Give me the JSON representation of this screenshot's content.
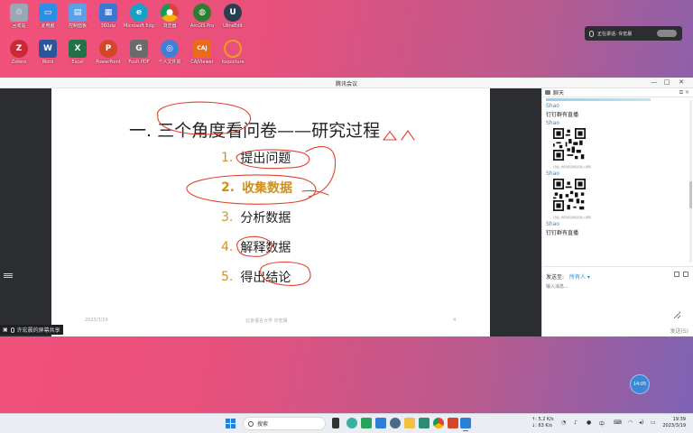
{
  "desktop": {
    "icons": [
      {
        "label": "回收站",
        "icon": "recycle-bin-icon",
        "color": "#9aa7b5"
      },
      {
        "label": "此电脑",
        "icon": "this-pc-icon",
        "color": "#2d8ee6"
      },
      {
        "label": "控制面板",
        "icon": "control-panel-icon",
        "color": "#5aa0e8"
      },
      {
        "label": "360zip",
        "icon": "archive-icon",
        "color": "#3a78d6"
      },
      {
        "label": "Microsoft Edge",
        "icon": "edge-icon",
        "color": "#1aa0c8"
      },
      {
        "label": "浏览器",
        "icon": "chrome-icon",
        "color": "#e4b321"
      },
      {
        "label": "ArcGIS Pro",
        "icon": "arcgis-icon",
        "color": "#2e7d32"
      },
      {
        "label": "UltraEdit",
        "icon": "ultraedit-icon",
        "color": "#2b3e4f"
      },
      {
        "label": "Zotero",
        "icon": "zotero-icon",
        "color": "#cc2936"
      },
      {
        "label": "Word",
        "icon": "word-icon",
        "color": "#2b579a"
      },
      {
        "label": "Excel",
        "icon": "excel-icon",
        "color": "#217346"
      },
      {
        "label": "PowerPoint",
        "icon": "powerpoint-icon",
        "color": "#d24726"
      },
      {
        "label": "Foxit PDF",
        "icon": "pdf-icon",
        "color": "#6b6b6b"
      },
      {
        "label": "个人文件夹",
        "icon": "network-icon",
        "color": "#3f7fd8"
      },
      {
        "label": "CAJViewer",
        "icon": "caj-icon",
        "color": "#ea6a1e"
      },
      {
        "label": "foxpicture",
        "icon": "picture-icon",
        "color": "#f29b24"
      }
    ]
  },
  "speaking_banner": {
    "text": "正在讲话: 许宏晨"
  },
  "meeting": {
    "window_title": "腾讯会议",
    "window_controls": [
      "—",
      "□",
      "✕"
    ],
    "slide": {
      "title": "一. 三个角度看问卷——研究过程",
      "items": [
        {
          "num": "1.",
          "text": "提出问题"
        },
        {
          "num": "2.",
          "text": "收集数据"
        },
        {
          "num": "3.",
          "text": "分析数据"
        },
        {
          "num": "4.",
          "text": "解释数据"
        },
        {
          "num": "5.",
          "text": "得出结论"
        }
      ],
      "footer_date": "2023/3/19",
      "footer_center": "北京语言大学 许宏晨",
      "footer_page": "4"
    },
    "share_tag": "许宏晨的屏幕共享"
  },
  "chat": {
    "title": "聊天",
    "messages": [
      {
        "name": "Shao",
        "text": "钉钉群有直播"
      },
      {
        "name": "Shao",
        "qr_caption": "扫描二维码或复制链接加入群聊"
      },
      {
        "name": "Shao",
        "qr_caption": "扫描二维码或复制链接加入群聊"
      },
      {
        "name": "Shao",
        "text": "钉钉群有直播"
      }
    ],
    "send_to_label": "发送至:",
    "send_to_target": "所有人 ▾",
    "input_placeholder": "输入消息...",
    "send_button": "发送(S)"
  },
  "float_timer": "14:05",
  "taskbar": {
    "search_placeholder": "搜索",
    "net_up": "↑: 5.2 K/s",
    "net_down": "↓: 63 K/s",
    "tray_lang": "中",
    "time": "19:39",
    "date": "2023/3/19"
  },
  "colors": {
    "accent": "#2a8ad4",
    "slide_highlight": "#d0901e",
    "ink": "#e0402c"
  }
}
